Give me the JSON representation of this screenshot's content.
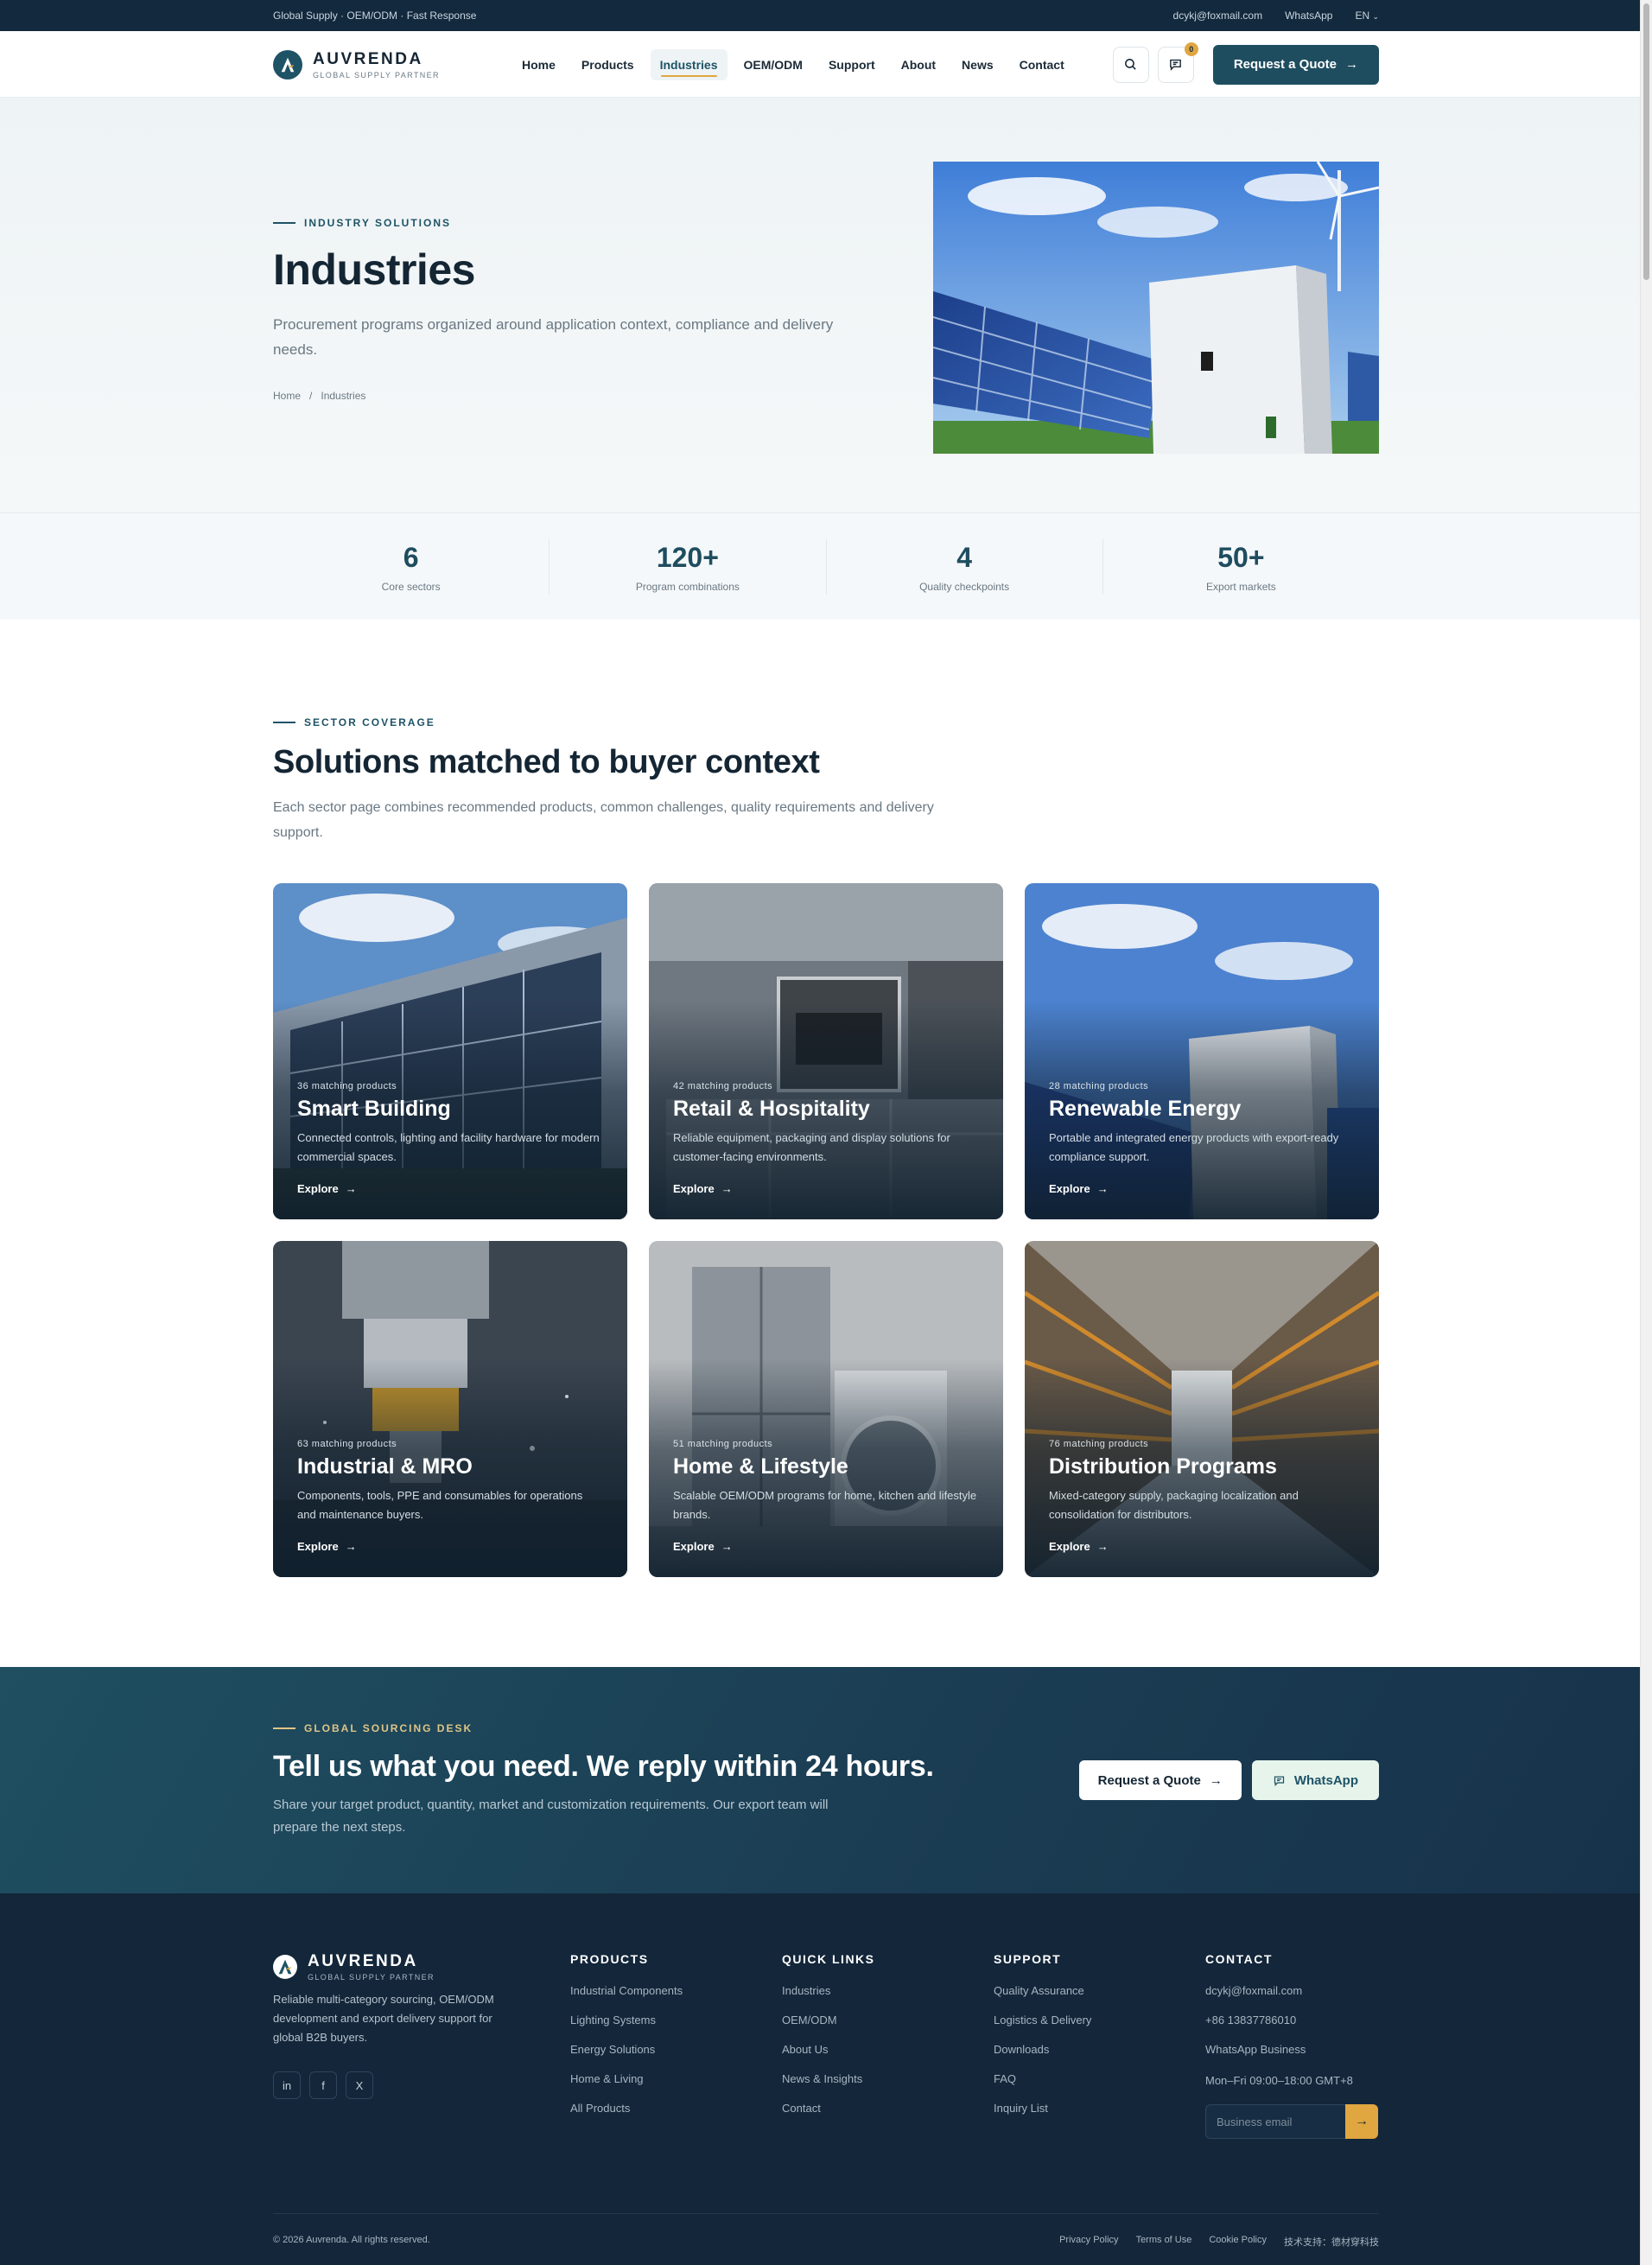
{
  "topbar": {
    "left": "Global Supply · OEM/ODM · Fast Response",
    "email": "dcykj@foxmail.com",
    "whatsapp": "WhatsApp",
    "lang": "EN"
  },
  "brand": {
    "name": "AUVRENDA",
    "tagline": "GLOBAL SUPPLY PARTNER",
    "accent": "#1e4d5f",
    "gold": "#e0a640"
  },
  "nav": {
    "items": [
      "Home",
      "Products",
      "Industries",
      "OEM/ODM",
      "Support",
      "About",
      "News",
      "Contact"
    ],
    "active": "Industries",
    "inquiry_count": "0",
    "quote_label": "Request a Quote"
  },
  "hero": {
    "eyebrow": "INDUSTRY SOLUTIONS",
    "title": "Industries",
    "description": "Procurement programs organized around application context, compliance and delivery needs.",
    "breadcrumb": [
      "Home",
      "Industries"
    ],
    "breadcrumb_sep": "/"
  },
  "stats": [
    {
      "value": "6",
      "label": "Core sectors"
    },
    {
      "value": "120+",
      "label": "Program combinations"
    },
    {
      "value": "4",
      "label": "Quality checkpoints"
    },
    {
      "value": "50+",
      "label": "Export markets"
    }
  ],
  "sectors": {
    "eyebrow": "SECTOR COVERAGE",
    "title": "Solutions matched to buyer context",
    "description": "Each sector page combines recommended products, common challenges, quality requirements and delivery support.",
    "explore_label": "Explore",
    "cards": [
      {
        "count": "36 matching products",
        "name": "Smart Building",
        "desc": "Connected controls, lighting and facility hardware for modern commercial spaces."
      },
      {
        "count": "42 matching products",
        "name": "Retail & Hospitality",
        "desc": "Reliable equipment, packaging and display solutions for customer-facing environments."
      },
      {
        "count": "28 matching products",
        "name": "Renewable Energy",
        "desc": "Portable and integrated energy products with export-ready compliance support."
      },
      {
        "count": "63 matching products",
        "name": "Industrial & MRO",
        "desc": "Components, tools, PPE and consumables for operations and maintenance buyers."
      },
      {
        "count": "51 matching products",
        "name": "Home & Lifestyle",
        "desc": "Scalable OEM/ODM programs for home, kitchen and lifestyle brands."
      },
      {
        "count": "76 matching products",
        "name": "Distribution Programs",
        "desc": "Mixed-category supply, packaging localization and consolidation for distributors."
      }
    ]
  },
  "cta": {
    "eyebrow": "GLOBAL SOURCING DESK",
    "title": "Tell us what you need. We reply within 24 hours.",
    "description": "Share your target product, quantity, market and customization requirements. Our export team will prepare the next steps.",
    "quote_label": "Request a Quote",
    "whatsapp_label": "WhatsApp"
  },
  "footer": {
    "about": "Reliable multi-category sourcing, OEM/ODM development and export delivery support for global B2B buyers.",
    "socials": [
      "in",
      "f",
      "X"
    ],
    "products": {
      "title": "PRODUCTS",
      "items": [
        "Industrial Components",
        "Lighting Systems",
        "Energy Solutions",
        "Home & Living",
        "All Products"
      ]
    },
    "quick_links": {
      "title": "QUICK LINKS",
      "items": [
        "Industries",
        "OEM/ODM",
        "About Us",
        "News & Insights",
        "Contact"
      ]
    },
    "support": {
      "title": "SUPPORT",
      "items": [
        "Quality Assurance",
        "Logistics & Delivery",
        "Downloads",
        "FAQ",
        "Inquiry List"
      ]
    },
    "contact": {
      "title": "CONTACT",
      "items": [
        "dcykj@foxmail.com",
        "+86 13837786010",
        "WhatsApp Business",
        "Mon–Fri 09:00–18:00 GMT+8"
      ]
    },
    "email_placeholder": "Business email",
    "copyright": "© 2026 Auvrenda. All rights reserved.",
    "legal": [
      "Privacy Policy",
      "Terms of Use",
      "Cookie Policy",
      "技术支持：德材穿科技"
    ]
  }
}
